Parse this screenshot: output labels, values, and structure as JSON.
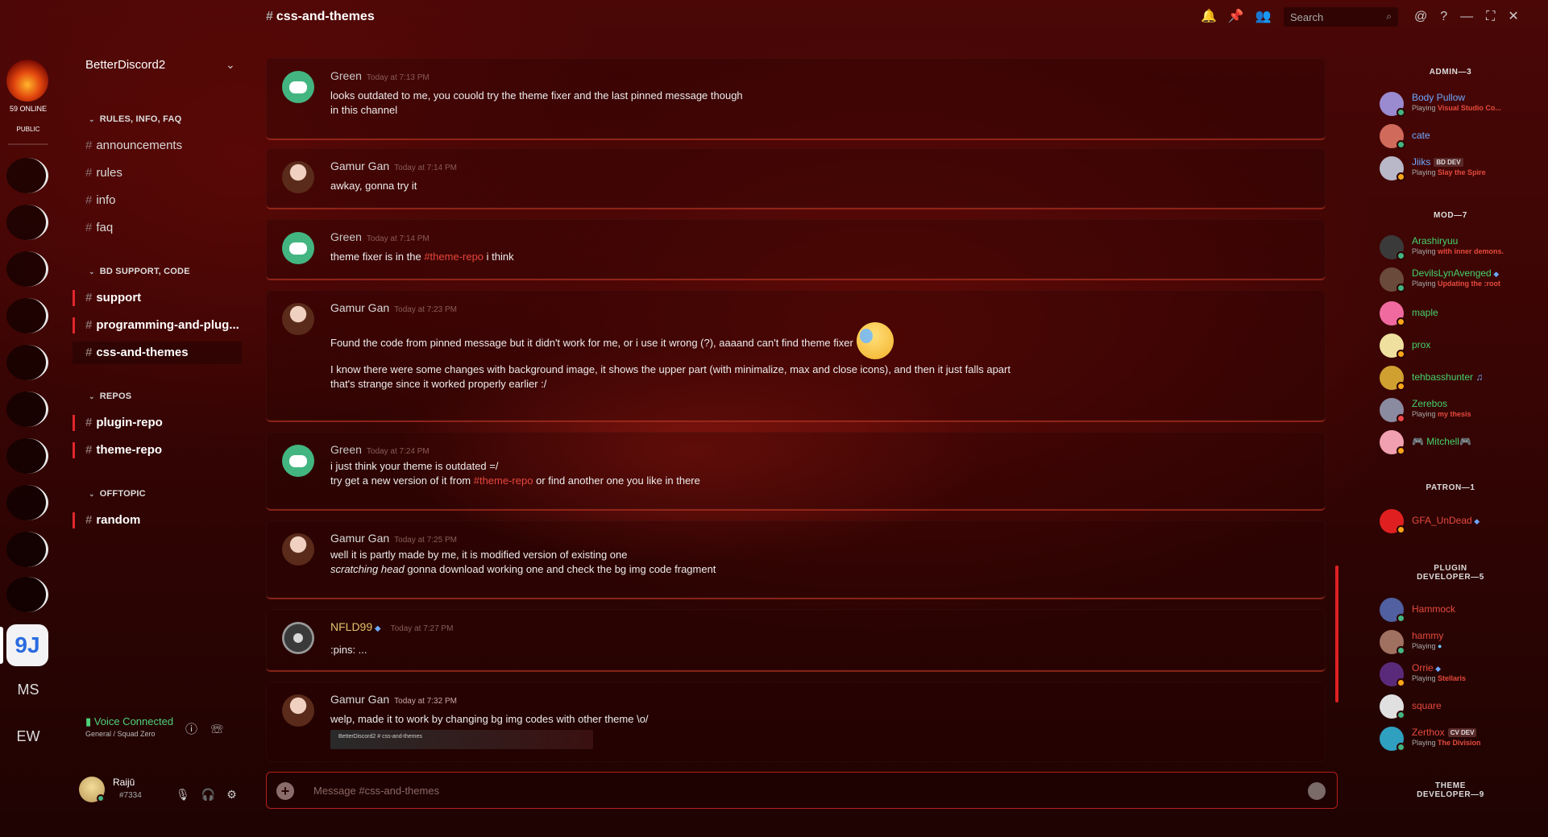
{
  "server_rail": {
    "online_count": "59 ONLINE",
    "public_badge": "PUBLIC",
    "active_server_glyph": "9J",
    "text_servers": [
      "MS",
      "EW"
    ]
  },
  "sidebar": {
    "server_name": "BetterDiscord2",
    "categories": [
      {
        "name": "RULES, INFO, FAQ",
        "channels": [
          "announcements",
          "rules",
          "info",
          "faq"
        ]
      },
      {
        "name": "BD SUPPORT, CODE",
        "channels": [
          "support",
          "programming-and-plug...",
          "css-and-themes"
        ]
      },
      {
        "name": "REPOS",
        "channels": [
          "plugin-repo",
          "theme-repo"
        ]
      },
      {
        "name": "OFFTOPIC",
        "channels": [
          "random"
        ]
      }
    ],
    "voice": {
      "status": "Voice Connected",
      "detail": "General / Squad Zero"
    },
    "user": {
      "name": "Raijū",
      "tag": "#7334"
    }
  },
  "header": {
    "channel": "css-and-themes",
    "search_placeholder": "Search"
  },
  "messages": [
    {
      "author": "Green",
      "time": "Today at 7:13 PM",
      "lines": [
        "looks outdated to me, you couold try the theme fixer and the last pinned message though",
        "in this channel"
      ]
    },
    {
      "author": "Gamur Gan",
      "time": "Today at 7:14 PM",
      "lines": [
        "awkay, gonna try it"
      ]
    },
    {
      "author": "Green",
      "time": "Today at 7:14 PM",
      "pre": "theme fixer is in the ",
      "mention": "#theme-repo",
      "post": " i think"
    },
    {
      "author": "Gamur Gan",
      "time": "Today at 7:23 PM",
      "line1": "Found the code from pinned message but it didn't work for me, or i use it wrong (?), aaaand can't find theme fixer",
      "line2": "I know there were some changes with background image, it shows the upper part (with minimalize, max and close icons), and then it just falls apart",
      "line3": "that's strange since it worked properly earlier :/"
    },
    {
      "author": "Green",
      "time": "Today at 7:24 PM",
      "line1": "i just think your theme is outdated =/",
      "pre": "try get a new version of it from ",
      "mention": "#theme-repo",
      "post": " or find another one you like in there"
    },
    {
      "author": "Gamur Gan",
      "time": "Today at 7:25 PM",
      "line1": "well it is partly made by me, it is modified version of existing one",
      "italic": "scratching head",
      "line2": " gonna download working one and check the bg img code fragment"
    },
    {
      "author": "NFLD99",
      "time": "Today at 7:27 PM",
      "line1": ":pins: ..."
    },
    {
      "author": "Gamur Gan",
      "time": "Today at 7:32 PM",
      "line1": "welp, made it to work by changing bg img codes with other theme \\o/",
      "embed_text": "BetterDiscord2        # css-and-themes"
    }
  ],
  "composer": {
    "placeholder": "Message #css-and-themes"
  },
  "members": {
    "roles": [
      "ADMIN—3",
      "MOD—7",
      "PATRON—1",
      "PLUGIN DEVELOPER—5",
      "THEME DEVELOPER—9"
    ],
    "list": [
      {
        "name": "Body Pullow",
        "activity_prefix": "Playing",
        "activity": "Visual Studio Co...",
        "color": "#6fa8ff",
        "avatar": "#9a8ad0",
        "status": "#43b581"
      },
      {
        "name": "cate",
        "color": "#6fa8ff",
        "avatar": "#d06a5a",
        "status": "#43b581"
      },
      {
        "name": "Jiiks",
        "tag": "BD DEV",
        "activity_prefix": "Playing",
        "activity": "Slay the Spire",
        "color": "#6fa8ff",
        "avatar": "#b8b8c8",
        "status": "#faa61a"
      },
      {
        "name": "Arashiryuu",
        "activity_prefix": "Playing",
        "activity": "with inner demons.",
        "color": "#43d36a",
        "avatar": "#3a3a3a",
        "status": "#43b581"
      },
      {
        "name": "DevilsLynAvenged",
        "activity_prefix": "Playing",
        "activity": "Updating the :root",
        "color": "#43d36a",
        "avatar": "#6a4a3a",
        "status": "#43b581"
      },
      {
        "name": "maple",
        "color": "#43d36a",
        "avatar": "#f06aa0",
        "status": "#faa61a"
      },
      {
        "name": "prox",
        "color": "#43d36a",
        "avatar": "#f0e0a0",
        "status": "#faa61a"
      },
      {
        "name": "tehbasshunter",
        "color": "#43d36a",
        "avatar": "#d0a030",
        "status": "#faa61a"
      },
      {
        "name": "Zerebos",
        "activity_prefix": "Playing",
        "activity": "my thesis",
        "color": "#43d36a",
        "avatar": "#8a8aa0",
        "status": "#f04747"
      },
      {
        "name": "🎮 Mitchell🎮",
        "color": "#43d36a",
        "avatar": "#f0a0b0",
        "status": "#faa61a"
      },
      {
        "name": "GFA_UnDead",
        "color": "#e64a3d",
        "avatar": "#e02020",
        "status": "#faa61a"
      },
      {
        "name": "Hammock",
        "color": "#e64a3d",
        "avatar": "#5060a0",
        "status": "#43b581"
      },
      {
        "name": "hammy",
        "activity_prefix": "Playing",
        "activity": "",
        "color": "#e64a3d",
        "avatar": "#a07060",
        "status": "#43b581"
      },
      {
        "name": "Orrie",
        "activity_prefix": "Playing",
        "activity": "Stellaris",
        "color": "#e64a3d",
        "avatar": "#5a2a7a",
        "status": "#faa61a"
      },
      {
        "name": "square",
        "color": "#e64a3d",
        "avatar": "#e0e0e0",
        "status": "#43b581"
      },
      {
        "name": "Zerthox",
        "tag": "CV DEV",
        "activity_prefix": "Playing",
        "activity": "The Division",
        "color": "#e64a3d",
        "avatar": "#30a0c0",
        "status": "#43b581"
      }
    ]
  }
}
